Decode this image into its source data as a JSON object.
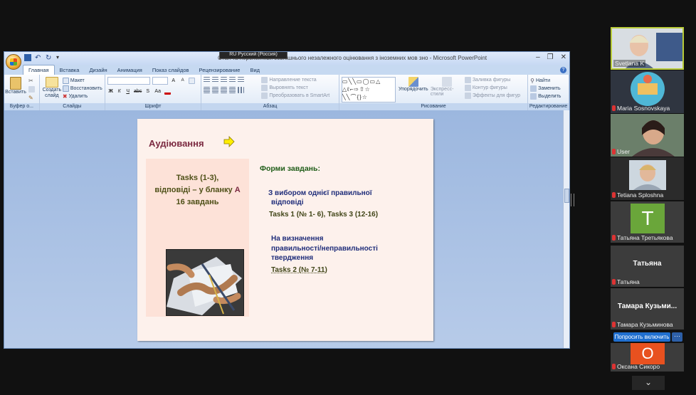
{
  "window": {
    "title": "Стан та перспективи зовнішнього незалежного оцінювання з іноземних мов зно - Microsoft PowerPoint",
    "language_bar": "RU Русский (Россия)"
  },
  "ribbon": {
    "tabs": [
      {
        "label": "Главная"
      },
      {
        "label": "Вставка"
      },
      {
        "label": "Дизайн"
      },
      {
        "label": "Анимация"
      },
      {
        "label": "Показ слайдов"
      },
      {
        "label": "Рецензирование"
      },
      {
        "label": "Вид"
      }
    ],
    "clipboard": {
      "paste": "Вставить",
      "label": "Буфер о..."
    },
    "slides": {
      "new_slide": "Создать слайд",
      "layout": "Макет",
      "reset": "Восстановить",
      "delete": "Удалить",
      "label": "Слайды"
    },
    "font": {
      "label": "Шрифт",
      "bold": "Ж",
      "italic": "К",
      "underline": "Ч",
      "strike": "abc",
      "shadow": "S",
      "case": "Аа",
      "grow": "A",
      "shrink": "A"
    },
    "paragraph": {
      "label": "Абзац",
      "direction": "Направление текста",
      "align_text": "Выровнять текст",
      "smartart": "Преобразовать в SmartArt"
    },
    "drawing": {
      "label": "Рисование",
      "arrange": "Упорядочить",
      "quick_styles": "Экспресс-стили",
      "fill": "Заливка фигуры",
      "outline": "Контур фигуры",
      "effects": "Эффекты для фигур"
    },
    "editing": {
      "label": "Редактирование",
      "find": "Найти",
      "replace": "Заменить",
      "select": "Выделить"
    }
  },
  "slide": {
    "title": "Аудіювання",
    "left_line1": "Tasks (1-3),",
    "left_line2a": "відповіді – у бланку ",
    "left_line2b": "А",
    "left_line3": "16 завдань",
    "forms_title": "Форми завдань:",
    "item1_line1": "З вибором однієї правильної",
    "item1_line2": "відповіді",
    "item1_tasks": "Tasks 1 (№ 1- 6), Tasks 3 (12-16)",
    "item2_line1": "На визначення",
    "item2_line2": "правильності/неправильності",
    "item2_line3": "твердження",
    "item2_tasks": "Tasks 2 (№ 7-11)"
  },
  "participants": [
    {
      "name": "Svetlana K",
      "active": true
    },
    {
      "name": "Maria Sosnovskaya"
    },
    {
      "name": "User"
    },
    {
      "name": "Tetiana Sploshna"
    },
    {
      "name": "Татьяна Третьякова",
      "avatar": "T",
      "color": "#6aa63a"
    },
    {
      "name": "Татьяна",
      "big_name": "Татьяна"
    },
    {
      "name": "Тамара Кузьминова",
      "big_name": "Тамара Кузьми..."
    },
    {
      "name": "Оксана Сикоро",
      "avatar": "О",
      "color": "#e8511f"
    }
  ],
  "controls": {
    "unmute": "Попросить включить",
    "more": "···",
    "scroll_down": "⌄"
  }
}
